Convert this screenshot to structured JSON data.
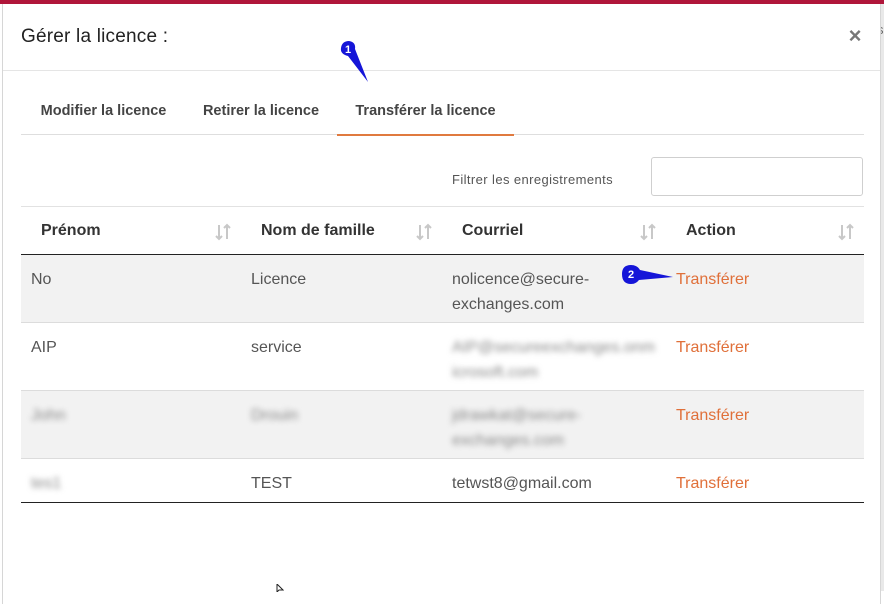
{
  "modal": {
    "title": "Gérer la licence :",
    "close_glyph": "×"
  },
  "tabs": [
    {
      "label": "Modifier la licence",
      "active": false
    },
    {
      "label": "Retirer la licence",
      "active": false
    },
    {
      "label": "Transférer la licence",
      "active": true
    }
  ],
  "filter": {
    "label": "Filtrer les enregistrements",
    "value": ""
  },
  "table": {
    "columns": [
      "Prénom",
      "Nom de famille",
      "Courriel",
      "Action"
    ],
    "rows": [
      {
        "first": "No",
        "last": "Licence",
        "email": "nolicence@secure-exchanges.com",
        "email_l1": "nolicence@secure-",
        "email_l2": "exchanges.com",
        "action": "Transférer",
        "blurred": false
      },
      {
        "first": "AIP",
        "last": "service",
        "email_l1": "AIP@secureexchanges.onm",
        "email_l2": "icrosoft.com",
        "action": "Transférer",
        "blurred_email": true
      },
      {
        "first": "John",
        "last": "Drouin",
        "email_l1": "jdrawkat@secure-",
        "email_l2": "exchanges.com",
        "action": "Transférer",
        "blurred": true
      },
      {
        "first": "tes1",
        "last": "TEST",
        "email": "tetwst8@gmail.com",
        "action": "Transférer",
        "blurred_first": true
      }
    ]
  },
  "annotations": [
    {
      "number": "1",
      "color": "#1515d8"
    },
    {
      "number": "2",
      "color": "#1515d8"
    }
  ],
  "colors": {
    "accent": "#e07a3f",
    "action_link": "#e0703a",
    "top_bar": "#b0163a"
  },
  "background": {
    "partial_letter": "s"
  }
}
